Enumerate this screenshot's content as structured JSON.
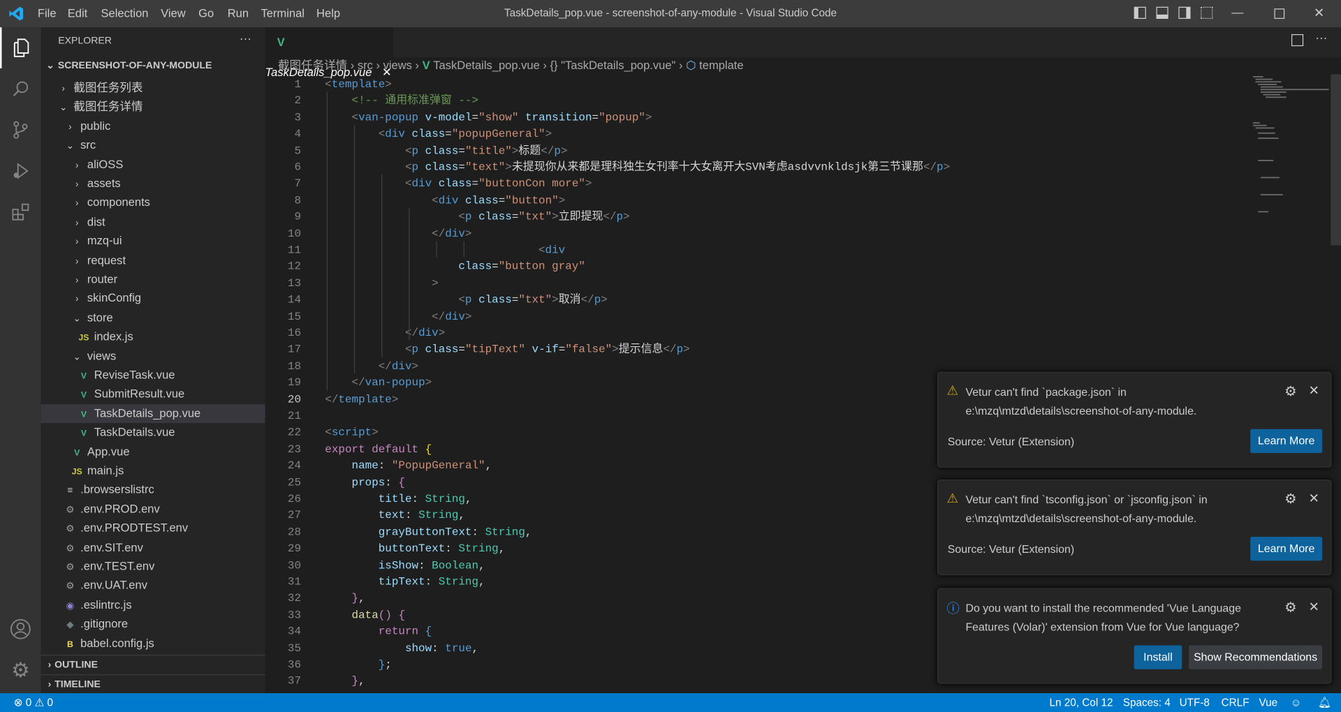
{
  "window": {
    "title": "TaskDetails_pop.vue - screenshot-of-any-module - Visual Studio Code"
  },
  "menu": [
    "File",
    "Edit",
    "Selection",
    "View",
    "Go",
    "Run",
    "Terminal",
    "Help"
  ],
  "sidebar": {
    "title": "EXPLORER",
    "more": "···",
    "root": "SCREENSHOT-OF-ANY-MODULE",
    "items": [
      {
        "label": "截图任务列表",
        "depth": 0,
        "icon": "chevron-right"
      },
      {
        "label": "截图任务详情",
        "depth": 0,
        "icon": "chevron-down"
      },
      {
        "label": "public",
        "depth": 1,
        "icon": "chevron-right"
      },
      {
        "label": "src",
        "depth": 1,
        "icon": "chevron-down"
      },
      {
        "label": "aliOSS",
        "depth": 2,
        "icon": "chevron-right"
      },
      {
        "label": "assets",
        "depth": 2,
        "icon": "chevron-right"
      },
      {
        "label": "components",
        "depth": 2,
        "icon": "chevron-right"
      },
      {
        "label": "dist",
        "depth": 2,
        "icon": "chevron-right"
      },
      {
        "label": "mzq-ui",
        "depth": 2,
        "icon": "chevron-right"
      },
      {
        "label": "request",
        "depth": 2,
        "icon": "chevron-right"
      },
      {
        "label": "router",
        "depth": 2,
        "icon": "chevron-right"
      },
      {
        "label": "skinConfig",
        "depth": 2,
        "icon": "chevron-right"
      },
      {
        "label": "store",
        "depth": 2,
        "icon": "chevron-down"
      },
      {
        "label": "index.js",
        "depth": 3,
        "icon": "js"
      },
      {
        "label": "views",
        "depth": 2,
        "icon": "chevron-down"
      },
      {
        "label": "ReviseTask.vue",
        "depth": 3,
        "icon": "vue"
      },
      {
        "label": "SubmitResult.vue",
        "depth": 3,
        "icon": "vue"
      },
      {
        "label": "TaskDetails_pop.vue",
        "depth": 3,
        "icon": "vue",
        "selected": true
      },
      {
        "label": "TaskDetails.vue",
        "depth": 3,
        "icon": "vue"
      },
      {
        "label": "App.vue",
        "depth": 2,
        "icon": "vue"
      },
      {
        "label": "main.js",
        "depth": 2,
        "icon": "js"
      },
      {
        "label": ".browserslistrc",
        "depth": 1,
        "icon": "lines"
      },
      {
        "label": ".env.PROD.env",
        "depth": 1,
        "icon": "gear"
      },
      {
        "label": ".env.PRODTEST.env",
        "depth": 1,
        "icon": "gear"
      },
      {
        "label": ".env.SIT.env",
        "depth": 1,
        "icon": "gear"
      },
      {
        "label": ".env.TEST.env",
        "depth": 1,
        "icon": "gear"
      },
      {
        "label": ".env.UAT.env",
        "depth": 1,
        "icon": "gear"
      },
      {
        "label": ".eslintrc.js",
        "depth": 1,
        "icon": "eslint"
      },
      {
        "label": ".gitignore",
        "depth": 1,
        "icon": "git"
      },
      {
        "label": "babel.config.js",
        "depth": 1,
        "icon": "babel"
      }
    ],
    "outline": "OUTLINE",
    "timeline": "TIMELINE"
  },
  "tab": {
    "label": "TaskDetails_pop.vue",
    "close": "✕"
  },
  "breadcrumb": [
    "截图任务详情",
    "src",
    "views",
    "TaskDetails_pop.vue",
    "{} \"TaskDetails_pop.vue\"",
    "template"
  ],
  "editor": {
    "current_line": 20,
    "lines": [
      [
        [
          "p",
          "<"
        ],
        [
          "k",
          "template"
        ],
        [
          "p",
          ">"
        ]
      ],
      [
        [
          "t",
          "    "
        ],
        [
          "c",
          "<!-- 通用标准弹窗 -->"
        ]
      ],
      [
        [
          "t",
          "    "
        ],
        [
          "p",
          "<"
        ],
        [
          "k",
          "van-popup"
        ],
        [
          "t",
          " "
        ],
        [
          "a",
          "v-model"
        ],
        [
          "t",
          "="
        ],
        [
          "s",
          "\"show\""
        ],
        [
          "t",
          " "
        ],
        [
          "a",
          "transition"
        ],
        [
          "t",
          "="
        ],
        [
          "s",
          "\"popup\""
        ],
        [
          "p",
          ">"
        ]
      ],
      [
        [
          "t",
          "        "
        ],
        [
          "p",
          "<"
        ],
        [
          "k",
          "div"
        ],
        [
          "t",
          " "
        ],
        [
          "a",
          "class"
        ],
        [
          "t",
          "="
        ],
        [
          "s",
          "\"popupGeneral\""
        ],
        [
          "p",
          ">"
        ]
      ],
      [
        [
          "t",
          "            "
        ],
        [
          "p",
          "<"
        ],
        [
          "k",
          "p"
        ],
        [
          "t",
          " "
        ],
        [
          "a",
          "class"
        ],
        [
          "t",
          "="
        ],
        [
          "s",
          "\"title\""
        ],
        [
          "p",
          ">"
        ],
        [
          "t",
          "标题"
        ],
        [
          "p",
          "</"
        ],
        [
          "k",
          "p"
        ],
        [
          "p",
          ">"
        ]
      ],
      [
        [
          "t",
          "            "
        ],
        [
          "p",
          "<"
        ],
        [
          "k",
          "p"
        ],
        [
          "t",
          " "
        ],
        [
          "a",
          "class"
        ],
        [
          "t",
          "="
        ],
        [
          "s",
          "\"text\""
        ],
        [
          "p",
          ">"
        ],
        [
          "t",
          "未提现你从来都是理科独生女刊率十大女离开大SVN考虑asdvvnkldsjk第三节课那"
        ],
        [
          "p",
          "</"
        ],
        [
          "k",
          "p"
        ],
        [
          "p",
          ">"
        ]
      ],
      [
        [
          "t",
          "            "
        ],
        [
          "p",
          "<"
        ],
        [
          "k",
          "div"
        ],
        [
          "t",
          " "
        ],
        [
          "a",
          "class"
        ],
        [
          "t",
          "="
        ],
        [
          "s",
          "\"buttonCon more\""
        ],
        [
          "p",
          ">"
        ]
      ],
      [
        [
          "t",
          "                "
        ],
        [
          "p",
          "<"
        ],
        [
          "k",
          "div"
        ],
        [
          "t",
          " "
        ],
        [
          "a",
          "class"
        ],
        [
          "t",
          "="
        ],
        [
          "s",
          "\"button\""
        ],
        [
          "p",
          ">"
        ]
      ],
      [
        [
          "t",
          "                    "
        ],
        [
          "p",
          "<"
        ],
        [
          "k",
          "p"
        ],
        [
          "t",
          " "
        ],
        [
          "a",
          "class"
        ],
        [
          "t",
          "="
        ],
        [
          "s",
          "\"txt\""
        ],
        [
          "p",
          ">"
        ],
        [
          "t",
          "立即提现"
        ],
        [
          "p",
          "</"
        ],
        [
          "k",
          "p"
        ],
        [
          "p",
          ">"
        ]
      ],
      [
        [
          "t",
          "                "
        ],
        [
          "p",
          "</"
        ],
        [
          "k",
          "div"
        ],
        [
          "p",
          ">"
        ]
      ],
      [
        [
          "t",
          "                                "
        ],
        [
          "p",
          "<"
        ],
        [
          "k",
          "div"
        ]
      ],
      [
        [
          "t",
          "                    "
        ],
        [
          "a",
          "class"
        ],
        [
          "t",
          "="
        ],
        [
          "s",
          "\"button gray\""
        ]
      ],
      [
        [
          "t",
          "                "
        ],
        [
          "p",
          ">"
        ]
      ],
      [
        [
          "t",
          "                    "
        ],
        [
          "p",
          "<"
        ],
        [
          "k",
          "p"
        ],
        [
          "t",
          " "
        ],
        [
          "a",
          "class"
        ],
        [
          "t",
          "="
        ],
        [
          "s",
          "\"txt\""
        ],
        [
          "p",
          ">"
        ],
        [
          "t",
          "取消"
        ],
        [
          "p",
          "</"
        ],
        [
          "k",
          "p"
        ],
        [
          "p",
          ">"
        ]
      ],
      [
        [
          "t",
          "                "
        ],
        [
          "p",
          "</"
        ],
        [
          "k",
          "div"
        ],
        [
          "p",
          ">"
        ]
      ],
      [
        [
          "t",
          "            "
        ],
        [
          "p",
          "</"
        ],
        [
          "k",
          "div"
        ],
        [
          "p",
          ">"
        ]
      ],
      [
        [
          "t",
          "            "
        ],
        [
          "p",
          "<"
        ],
        [
          "k",
          "p"
        ],
        [
          "t",
          " "
        ],
        [
          "a",
          "class"
        ],
        [
          "t",
          "="
        ],
        [
          "s",
          "\"tipText\""
        ],
        [
          "t",
          " "
        ],
        [
          "a",
          "v-if"
        ],
        [
          "t",
          "="
        ],
        [
          "s",
          "\"false\""
        ],
        [
          "p",
          ">"
        ],
        [
          "t",
          "提示信息"
        ],
        [
          "p",
          "</"
        ],
        [
          "k",
          "p"
        ],
        [
          "p",
          ">"
        ]
      ],
      [
        [
          "t",
          "        "
        ],
        [
          "p",
          "</"
        ],
        [
          "k",
          "div"
        ],
        [
          "p",
          ">"
        ]
      ],
      [
        [
          "t",
          "    "
        ],
        [
          "p",
          "</"
        ],
        [
          "k",
          "van-popup"
        ],
        [
          "p",
          ">"
        ]
      ],
      [
        [
          "p",
          "</"
        ],
        [
          "k",
          "template"
        ],
        [
          "p",
          ">"
        ]
      ],
      [],
      [
        [
          "p",
          "<"
        ],
        [
          "k",
          "script"
        ],
        [
          "p",
          ">"
        ]
      ],
      [
        [
          "m",
          "export"
        ],
        [
          "t",
          " "
        ],
        [
          "m",
          "default"
        ],
        [
          "t",
          " "
        ],
        [
          "b",
          "{"
        ]
      ],
      [
        [
          "t",
          "    "
        ],
        [
          "a",
          "name"
        ],
        [
          "t",
          ": "
        ],
        [
          "s",
          "\"PopupGeneral\""
        ],
        [
          "t",
          ","
        ]
      ],
      [
        [
          "t",
          "    "
        ],
        [
          "a",
          "props"
        ],
        [
          "t",
          ": "
        ],
        [
          "m",
          "{"
        ]
      ],
      [
        [
          "t",
          "        "
        ],
        [
          "a",
          "title"
        ],
        [
          "t",
          ": "
        ],
        [
          "ty",
          "String"
        ],
        [
          "t",
          ","
        ]
      ],
      [
        [
          "t",
          "        "
        ],
        [
          "a",
          "text"
        ],
        [
          "t",
          ": "
        ],
        [
          "ty",
          "String"
        ],
        [
          "t",
          ","
        ]
      ],
      [
        [
          "t",
          "        "
        ],
        [
          "a",
          "grayButtonText"
        ],
        [
          "t",
          ": "
        ],
        [
          "ty",
          "String"
        ],
        [
          "t",
          ","
        ]
      ],
      [
        [
          "t",
          "        "
        ],
        [
          "a",
          "buttonText"
        ],
        [
          "t",
          ": "
        ],
        [
          "ty",
          "String"
        ],
        [
          "t",
          ","
        ]
      ],
      [
        [
          "t",
          "        "
        ],
        [
          "a",
          "isShow"
        ],
        [
          "t",
          ": "
        ],
        [
          "ty",
          "Boolean"
        ],
        [
          "t",
          ","
        ]
      ],
      [
        [
          "t",
          "        "
        ],
        [
          "a",
          "tipText"
        ],
        [
          "t",
          ": "
        ],
        [
          "ty",
          "String"
        ],
        [
          "t",
          ","
        ]
      ],
      [
        [
          "t",
          "    "
        ],
        [
          "m",
          "}"
        ],
        [
          "t",
          ","
        ]
      ],
      [
        [
          "t",
          "    "
        ],
        [
          "f",
          "data"
        ],
        [
          "m",
          "()"
        ],
        [
          "t",
          " "
        ],
        [
          "m",
          "{"
        ]
      ],
      [
        [
          "t",
          "        "
        ],
        [
          "m",
          "return"
        ],
        [
          "t",
          " "
        ],
        [
          "k",
          "{"
        ]
      ],
      [
        [
          "t",
          "            "
        ],
        [
          "a",
          "show"
        ],
        [
          "t",
          ": "
        ],
        [
          "k",
          "true"
        ],
        [
          "t",
          ","
        ]
      ],
      [
        [
          "t",
          "        "
        ],
        [
          "k",
          "}"
        ],
        [
          "t",
          ";"
        ]
      ],
      [
        [
          "t",
          "    "
        ],
        [
          "m",
          "}"
        ],
        [
          "t",
          ","
        ]
      ]
    ]
  },
  "notifications": [
    {
      "type": "warning",
      "message": "Vetur can't find `package.json` in e:\\mzq\\mtzd\\details\\screenshot-of-any-module.",
      "source": "Source: Vetur (Extension)",
      "buttons": [
        "Learn More"
      ]
    },
    {
      "type": "warning",
      "message": "Vetur can't find `tsconfig.json` or `jsconfig.json` in e:\\mzq\\mtzd\\details\\screenshot-of-any-module.",
      "source": "Source: Vetur (Extension)",
      "buttons": [
        "Learn More"
      ]
    },
    {
      "type": "info",
      "message": "Do you want to install the recommended 'Vue Language Features (Volar)' extension from Vue for Vue language?",
      "source": "",
      "buttons": [
        "Install",
        "Show Recommendations"
      ]
    }
  ],
  "status": {
    "errors": "0",
    "warnings": "0",
    "position": "Ln 20, Col 12",
    "spaces": "Spaces: 4",
    "encoding": "UTF-8",
    "eol": "CRLF",
    "language": "Vue"
  },
  "colors": {
    "statusbar": "#007acc",
    "button": "#0e639c",
    "vue": "#41b883",
    "js": "#cbcb41",
    "warning": "#cca700",
    "info": "#3794ff"
  }
}
